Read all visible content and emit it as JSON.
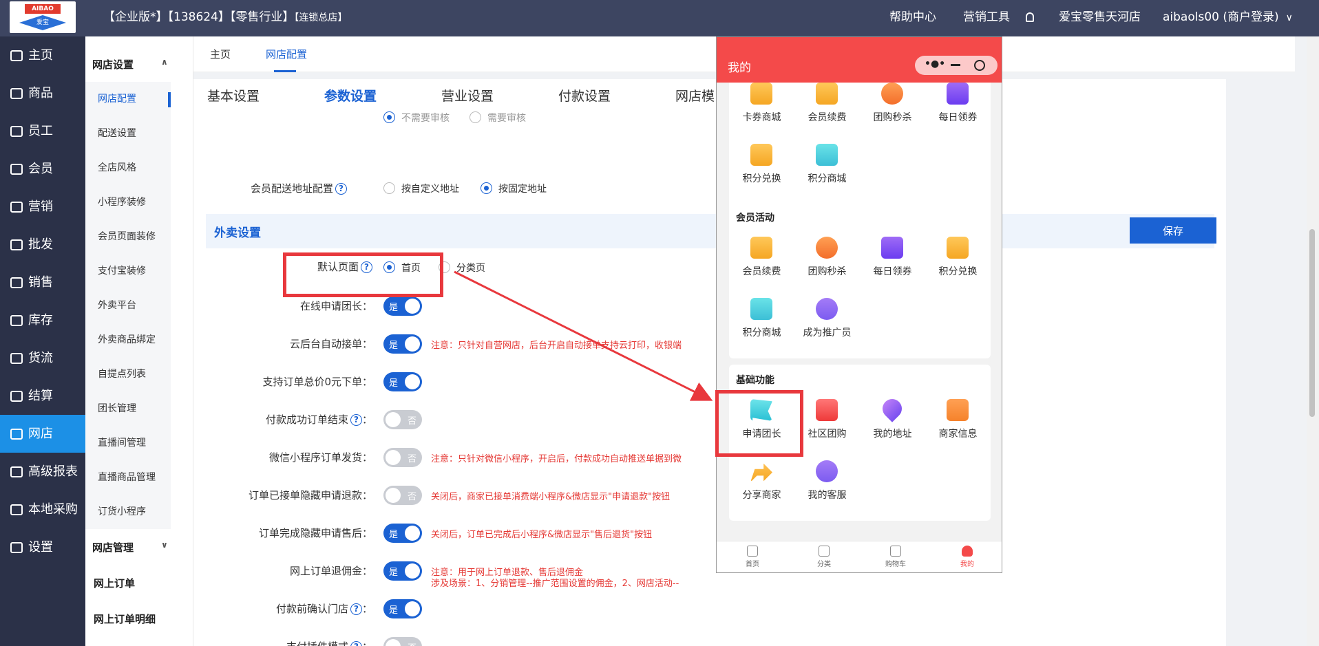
{
  "topbar": {
    "logo_text_top": "AIBAO",
    "logo_text_bottom": "爱宝",
    "title_main": "【企业版*】【138624】【零售行业】",
    "title_small": "【连锁总店】",
    "help": "帮助中心",
    "marketing_tools": "营销工具",
    "store": "爱宝零售天河店",
    "user": "aibaols00 (商户登录)"
  },
  "sidebar": {
    "items": [
      {
        "label": "主页"
      },
      {
        "label": "商品"
      },
      {
        "label": "员工"
      },
      {
        "label": "会员"
      },
      {
        "label": "营销"
      },
      {
        "label": "批发"
      },
      {
        "label": "销售"
      },
      {
        "label": "库存"
      },
      {
        "label": "货流"
      },
      {
        "label": "结算"
      },
      {
        "label": "网店"
      },
      {
        "label": "高级报表"
      },
      {
        "label": "本地采购"
      },
      {
        "label": "设置"
      }
    ],
    "active_index": 10
  },
  "subnav": {
    "group1": "网店设置",
    "items": [
      "网店配置",
      "配送设置",
      "全店风格",
      "小程序装修",
      "会员页面装修",
      "支付宝装修",
      "外卖平台",
      "外卖商品绑定",
      "自提点列表",
      "团长管理",
      "直播间管理",
      "直播商品管理",
      "订货小程序"
    ],
    "group2": "网店管理",
    "plain1": "网上订单",
    "plain2": "网上订单明细"
  },
  "top_tabs": [
    "主页",
    "网店配置"
  ],
  "sub_tabs": [
    "基本设置",
    "参数设置",
    "营业设置",
    "付款设置",
    "网店模"
  ],
  "form": {
    "cut_row_options": [
      "不需要审核",
      "需要审核"
    ],
    "delivery_addr_label": "会员配送地址配置",
    "delivery_addr_opt1": "按自定义地址",
    "delivery_addr_opt2": "按固定地址",
    "section_title": "外卖设置",
    "save": "保存",
    "default_page_label": "默认页面",
    "default_page_opt1": "首页",
    "default_page_opt2": "分类页",
    "rows": [
      {
        "label": "在线申请团长：",
        "state": "是",
        "note": ""
      },
      {
        "label": "云后台自动接单：",
        "state": "是",
        "note": "注意：只针对自营网店，后台开启自动接单支持云打印，收银端"
      },
      {
        "label": "支持订单总价0元下单：",
        "state": "是",
        "note": ""
      },
      {
        "label": "付款成功订单结束",
        "state": "否",
        "note": ""
      },
      {
        "label": "微信小程序订单发货：",
        "state": "否",
        "note": "注意：只针对微信小程序，开启后，付款成功自动推送单据到微"
      },
      {
        "label": "订单已接单隐藏申请退款：",
        "state": "否",
        "note": "关闭后，商家已接单消费端小程序&微店显示\"申请退款\"按钮"
      },
      {
        "label": "订单完成隐藏申请售后：",
        "state": "是",
        "note": "关闭后，订单已完成后小程序&微店显示\"售后退货\"按钮"
      },
      {
        "label": "网上订单退佣金：",
        "state": "是",
        "note": "注意：用于网上订单退款、售后退佣金"
      },
      {
        "label": "付款前确认门店",
        "state": "是",
        "note": ""
      },
      {
        "label": "支付插件模式",
        "state": "否",
        "note": ""
      }
    ],
    "commission_note2": "涉及场景：1、分销管理--推广范围设置的佣金，2、网店活动--"
  },
  "phone": {
    "title": "我的",
    "card0_items": [
      {
        "label": "卡券商城",
        "icon": "coupon-icon",
        "cls": "gold"
      },
      {
        "label": "会员续费",
        "icon": "yen-icon",
        "cls": "gold"
      },
      {
        "label": "团购秒杀",
        "icon": "lightning-icon",
        "cls": "orange"
      },
      {
        "label": "每日领券",
        "icon": "ticket-icon",
        "cls": "purple"
      },
      {
        "label": "积分兑换",
        "icon": "gift-icon",
        "cls": "gold"
      },
      {
        "label": "积分商城",
        "icon": "shop-icon",
        "cls": "teal"
      }
    ],
    "card1_title": "会员活动",
    "card1_items": [
      {
        "label": "会员续费",
        "icon": "yen-icon",
        "cls": "gold"
      },
      {
        "label": "团购秒杀",
        "icon": "lightning-icon",
        "cls": "orange"
      },
      {
        "label": "每日领券",
        "icon": "ticket-icon",
        "cls": "purple"
      },
      {
        "label": "积分兑换",
        "icon": "gift-icon",
        "cls": "gold"
      },
      {
        "label": "积分商城",
        "icon": "shop-icon",
        "cls": "teal"
      },
      {
        "label": "成为推广员",
        "icon": "smile-icon",
        "cls": "violet"
      }
    ],
    "card2_title": "基础功能",
    "card2_items": [
      {
        "label": "申请团长",
        "icon": "flag-icon",
        "cls": "flag"
      },
      {
        "label": "社区团购",
        "icon": "house-icon",
        "cls": "red"
      },
      {
        "label": "我的地址",
        "icon": "location-pin-icon",
        "cls": "pin"
      },
      {
        "label": "商家信息",
        "icon": "id-card-icon",
        "cls": "card-i"
      },
      {
        "label": "分享商家",
        "icon": "share-arrow-icon",
        "cls": "arrow"
      },
      {
        "label": "我的客服",
        "icon": "service-icon",
        "cls": "violet"
      }
    ],
    "tabbar": [
      "首页",
      "分类",
      "购物车",
      "我的"
    ]
  },
  "colors": {
    "accent": "#1b62d3",
    "topbar": "#3d4561",
    "sidebar": "#2b3148",
    "highlight": "#e8383d",
    "phone_header": "#f44a4a"
  }
}
